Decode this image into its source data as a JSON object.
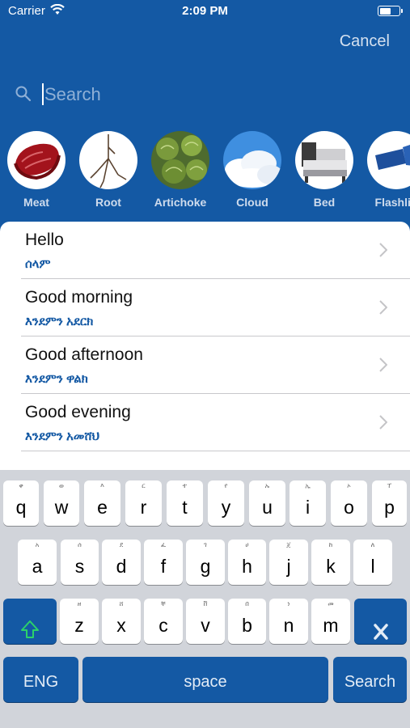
{
  "status_bar": {
    "carrier": "Carrier",
    "time": "2:09 PM"
  },
  "header": {
    "cancel_label": "Cancel"
  },
  "search": {
    "placeholder": "Search"
  },
  "categories": [
    {
      "label": "Meat",
      "icon": "meat-photo"
    },
    {
      "label": "Root",
      "icon": "root-photo"
    },
    {
      "label": "Artichoke",
      "icon": "artichoke-photo"
    },
    {
      "label": "Cloud",
      "icon": "cloud-photo"
    },
    {
      "label": "Bed",
      "icon": "bed-photo"
    },
    {
      "label": "Flashlig",
      "icon": "flashlight-photo"
    }
  ],
  "phrases": [
    {
      "english": "Hello",
      "amharic": "ሰላም"
    },
    {
      "english": "Good morning",
      "amharic": "እንደምን አደርክ"
    },
    {
      "english": "Good afternoon",
      "amharic": "እንደምን ዋልክ"
    },
    {
      "english": "Good evening",
      "amharic": "እንደምን አመሸህ"
    }
  ],
  "keyboard": {
    "row1": [
      {
        "letter": "q",
        "hint": "ቀ"
      },
      {
        "letter": "w",
        "hint": "ወ"
      },
      {
        "letter": "e",
        "hint": "እ"
      },
      {
        "letter": "r",
        "hint": "ር"
      },
      {
        "letter": "t",
        "hint": "ተ"
      },
      {
        "letter": "y",
        "hint": "የ"
      },
      {
        "letter": "u",
        "hint": "ኡ"
      },
      {
        "letter": "i",
        "hint": "ኢ"
      },
      {
        "letter": "o",
        "hint": "ኦ"
      },
      {
        "letter": "p",
        "hint": "ፐ"
      }
    ],
    "row2": [
      {
        "letter": "a",
        "hint": "አ"
      },
      {
        "letter": "s",
        "hint": "ሰ"
      },
      {
        "letter": "d",
        "hint": "ደ"
      },
      {
        "letter": "f",
        "hint": "ፈ"
      },
      {
        "letter": "g",
        "hint": "ገ"
      },
      {
        "letter": "h",
        "hint": "ሀ"
      },
      {
        "letter": "j",
        "hint": "ጀ"
      },
      {
        "letter": "k",
        "hint": "ከ"
      },
      {
        "letter": "l",
        "hint": "ለ"
      }
    ],
    "row3": [
      {
        "letter": "z",
        "hint": "ዘ"
      },
      {
        "letter": "x",
        "hint": "ሸ"
      },
      {
        "letter": "c",
        "hint": "ቸ"
      },
      {
        "letter": "v",
        "hint": "ቨ"
      },
      {
        "letter": "b",
        "hint": "በ"
      },
      {
        "letter": "n",
        "hint": "ነ"
      },
      {
        "letter": "m",
        "hint": "መ"
      }
    ],
    "lang_label": "ENG",
    "space_label": "space",
    "search_label": "Search",
    "shift_icon": "shift-arrow-icon",
    "delete_icon": "delete-x-icon"
  },
  "colors": {
    "primary": "#1459a4",
    "keyboard_bg": "#d1d4da",
    "amharic_text": "#1459a4"
  }
}
